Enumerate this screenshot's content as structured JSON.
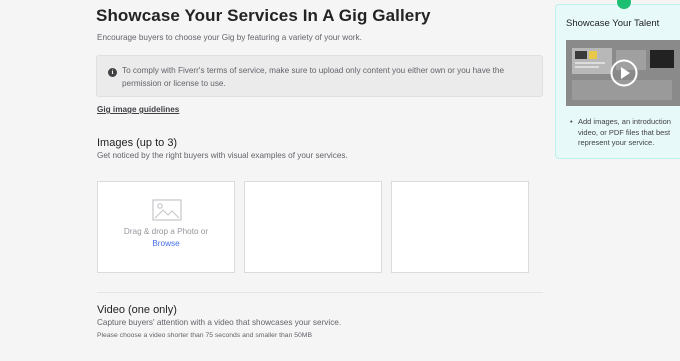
{
  "header": {
    "title": "Showcase Your Services In A Gig Gallery",
    "subtitle": "Encourage buyers to choose your Gig by featuring a variety of your work."
  },
  "notice": {
    "icon": "info-icon",
    "text": "To comply with Fiverr's terms of service, make sure to upload only content you either own or you have the permission or license to use."
  },
  "guidelines_link": "Gig image guidelines",
  "images": {
    "title": "Images (up to 3)",
    "description": "Get noticed by the right buyers with visual examples of your services.",
    "dropzone_text": "Drag & drop a Photo or",
    "browse_label": "Browse"
  },
  "video": {
    "title": "Video (one only)",
    "description": "Capture buyers' attention with a video that showcases your service.",
    "note": "Please choose a video shorter than 75 seconds and smaller than 50MB"
  },
  "tip": {
    "title": "Showcase Your Talent",
    "items": [
      "Add images, an introduction video, or PDF files that best represent your service."
    ]
  },
  "colors": {
    "accent": "#1dbf73",
    "link": "#446ee7",
    "tip_background": "#e8f9f9"
  }
}
